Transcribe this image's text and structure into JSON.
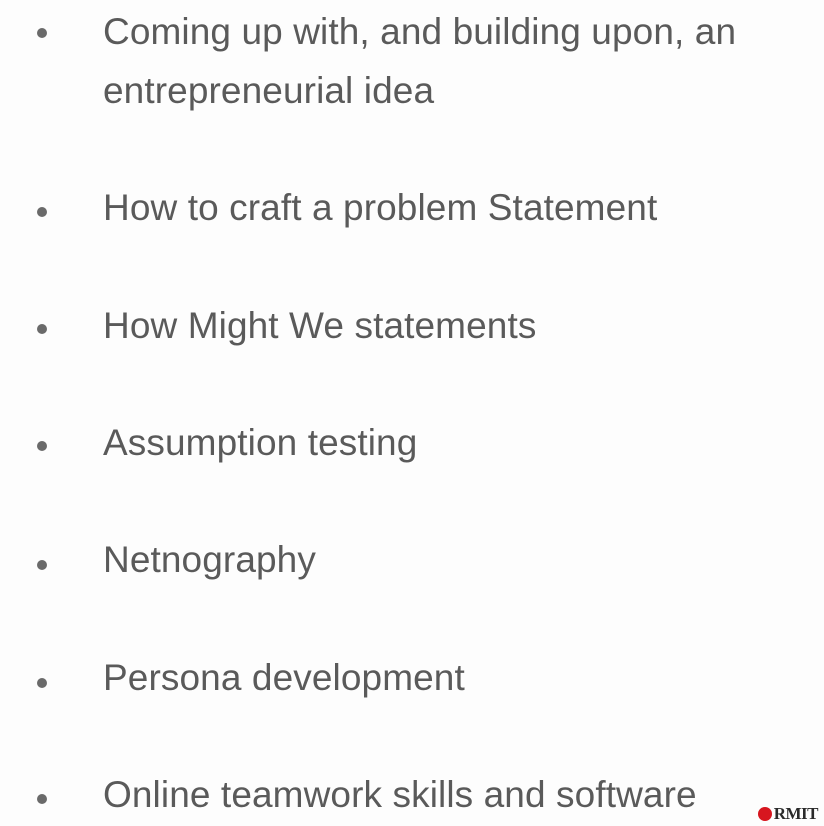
{
  "bullets": [
    "Coming up with, and building upon, an entrepreneurial idea",
    "How to craft a problem Statement",
    "How Might We statements",
    "Assumption testing",
    "Netnography",
    "Persona development",
    "Online teamwork skills and software"
  ],
  "logo": {
    "text": "RMIT",
    "dot_color": "#d7161f"
  }
}
